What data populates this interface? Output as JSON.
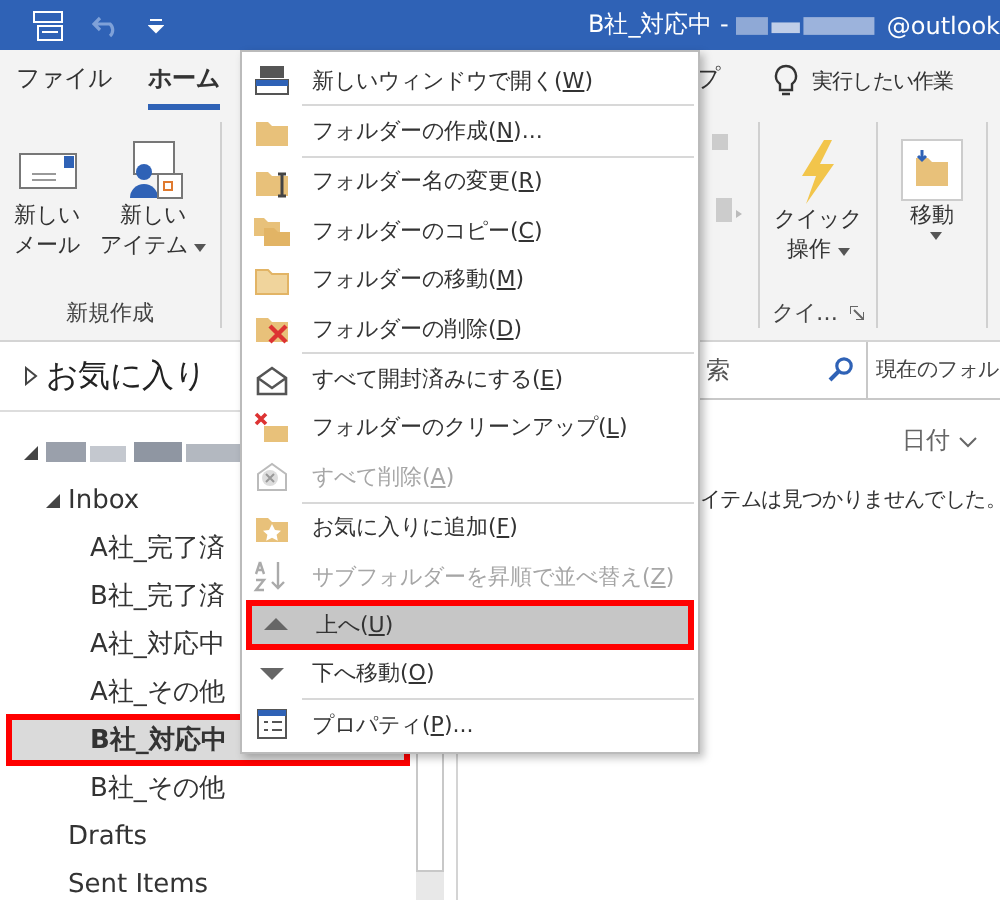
{
  "title_bar": {
    "title": "B社_対応中 -",
    "account_suffix": "@outlook"
  },
  "ribbon": {
    "tabs": [
      {
        "label": "ファイル",
        "selected": false
      },
      {
        "label": "ホーム",
        "selected": true
      },
      {
        "label": "プ",
        "selected": false
      }
    ],
    "tell_me": "実行したい作業",
    "new_group": {
      "label": "新規作成",
      "buttons": [
        {
          "lines": [
            "新しい",
            "メール"
          ],
          "dropdown": false
        },
        {
          "lines": [
            "新しい",
            "アイテム"
          ],
          "dropdown": true
        }
      ]
    },
    "quick_group": {
      "label": "クイ…",
      "button_lines": [
        "クイック",
        "操作"
      ]
    },
    "move_button": {
      "label": "移動"
    }
  },
  "search": {
    "placeholder": "索",
    "scope": "現在のフォル"
  },
  "message_list": {
    "sort": "日付",
    "empty_text": "イテムは見つかりませんでした。"
  },
  "folder_pane": {
    "favorites": {
      "label": "お気に入り",
      "expanded": false
    },
    "tree": [
      {
        "expanded": true,
        "children": [
          {
            "label": "Inbox",
            "expanded": true,
            "children": [
              {
                "label": "A社_完了済",
                "selected": false
              },
              {
                "label": "B社_完了済",
                "selected": false
              },
              {
                "label": "A社_対応中",
                "selected": false
              },
              {
                "label": "A社_その他",
                "selected": false
              },
              {
                "label": "B社_対応中",
                "selected": true
              },
              {
                "label": "B社_その他",
                "selected": false
              }
            ]
          },
          {
            "label": "Drafts",
            "selected": false
          },
          {
            "label": "Sent Items",
            "selected": false
          }
        ]
      }
    ]
  },
  "context_menu": {
    "items": [
      {
        "before": "新しいウィンドウで開く(",
        "key": "W",
        "after": ")",
        "disabled": false,
        "selected": false,
        "separator_after": true
      },
      {
        "before": "フォルダーの作成(",
        "key": "N",
        "after": ")...",
        "disabled": false,
        "selected": false,
        "separator_after": true
      },
      {
        "before": "フォルダー名の変更(",
        "key": "R",
        "after": ")",
        "disabled": false,
        "selected": false,
        "separator_after": false
      },
      {
        "before": "フォルダーのコピー(",
        "key": "C",
        "after": ")",
        "disabled": false,
        "selected": false,
        "separator_after": false
      },
      {
        "before": "フォルダーの移動(",
        "key": "M",
        "after": ")",
        "disabled": false,
        "selected": false,
        "separator_after": false
      },
      {
        "before": "フォルダーの削除(",
        "key": "D",
        "after": ")",
        "disabled": false,
        "selected": false,
        "separator_after": true
      },
      {
        "before": "すべて開封済みにする(",
        "key": "E",
        "after": ")",
        "disabled": false,
        "selected": false,
        "separator_after": false
      },
      {
        "before": "フォルダーのクリーンアップ(",
        "key": "L",
        "after": ")",
        "disabled": false,
        "selected": false,
        "separator_after": false
      },
      {
        "before": "すべて削除(",
        "key": "A",
        "after": ")",
        "disabled": true,
        "selected": false,
        "separator_after": true
      },
      {
        "before": "お気に入りに追加(",
        "key": "F",
        "after": ")",
        "disabled": false,
        "selected": false,
        "separator_after": false
      },
      {
        "before": "サブフォルダーを昇順で並べ替え(",
        "key": "Z",
        "after": ")",
        "disabled": true,
        "selected": false,
        "separator_after": false
      },
      {
        "before": "上へ(",
        "key": "U",
        "after": ")",
        "disabled": false,
        "selected": true,
        "separator_after": false
      },
      {
        "before": "下へ移動(",
        "key": "O",
        "after": ")",
        "disabled": false,
        "selected": false,
        "separator_after": true
      },
      {
        "before": "プロパティ(",
        "key": "P",
        "after": ")...",
        "disabled": false,
        "selected": false,
        "separator_after": false
      }
    ]
  }
}
